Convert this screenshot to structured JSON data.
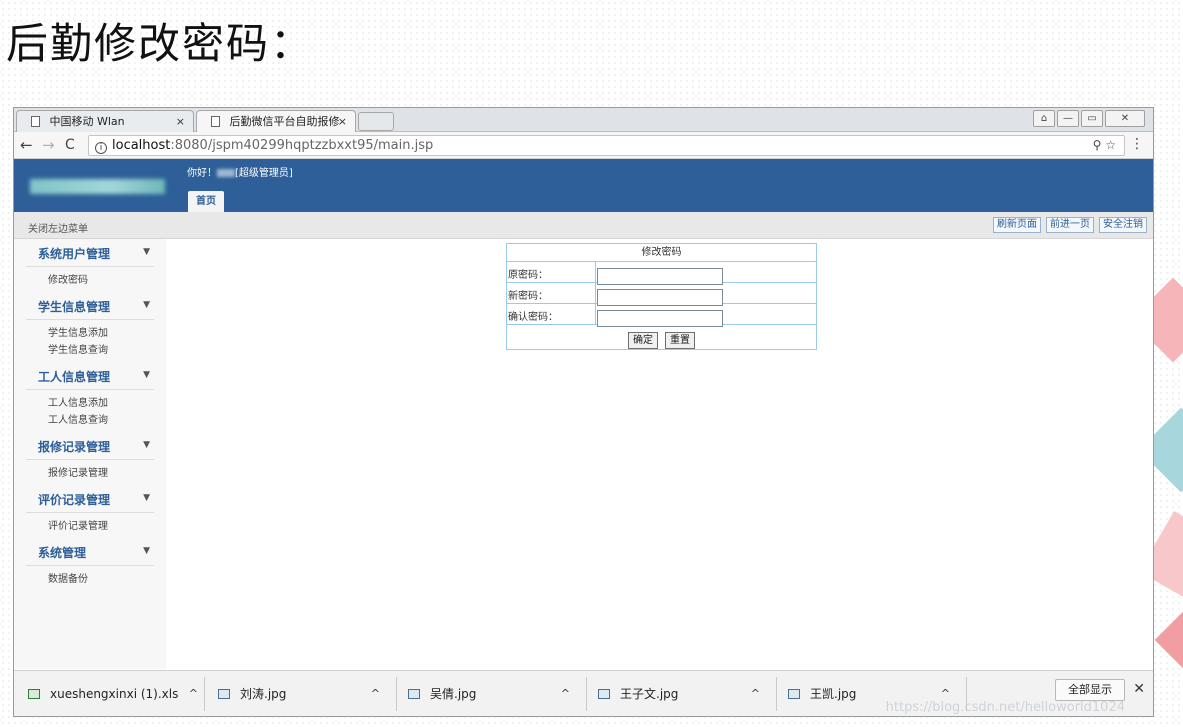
{
  "slide_title": "后勤修改密码：",
  "browser": {
    "tabs": [
      {
        "title": "中国移动 Wlan",
        "close": "×"
      },
      {
        "title": "后勤微信平台自助报修系",
        "close": "×"
      }
    ],
    "window_controls": {
      "user": "⌂",
      "minimize": "—",
      "maximize": "▭",
      "close": "✕"
    },
    "url_host": "localhost",
    "url_path": ":8080/jspm40299hqptzzbxxt95/main.jsp",
    "nav": {
      "back": "←",
      "forward": "→",
      "reload": "C"
    },
    "info_icon": "i",
    "omnibox_icons": "⚲ ☆",
    "menu": "⋮"
  },
  "app": {
    "greeting_prefix": "你好！",
    "greeting_role": "[超级管理员]",
    "home_tab": "首页",
    "toggle_menu": "关闭左边菜单",
    "actions": {
      "refresh": "刷新页面",
      "forward": "前进一页",
      "logout": "安全注销"
    },
    "sidebar": {
      "chevron": "▼",
      "g1": {
        "title": "系统用户管理",
        "items": [
          "修改密码"
        ]
      },
      "g2": {
        "title": "学生信息管理",
        "items": [
          "学生信息添加",
          "学生信息查询"
        ]
      },
      "g3": {
        "title": "工人信息管理",
        "items": [
          "工人信息添加",
          "工人信息查询"
        ]
      },
      "g4": {
        "title": "报修记录管理",
        "items": [
          "报修记录管理"
        ]
      },
      "g5": {
        "title": "评价记录管理",
        "items": [
          "评价记录管理"
        ]
      },
      "g6": {
        "title": "系统管理",
        "items": [
          "数据备份"
        ]
      }
    },
    "form": {
      "title": "修改密码",
      "old_label": "原密码：",
      "new_label": "新密码：",
      "confirm_label": "确认密码：",
      "old_value": "",
      "new_value": "",
      "confirm_value": "",
      "submit": "确定",
      "reset": "重置"
    }
  },
  "downloads": {
    "items": [
      {
        "name": "xueshengxinxi (1).xls"
      },
      {
        "name": "刘涛.jpg"
      },
      {
        "name": "吴倩.jpg"
      },
      {
        "name": "王子文.jpg"
      },
      {
        "name": "王凯.jpg"
      }
    ],
    "chevron": "^",
    "show_all": "全部显示",
    "close": "✕"
  },
  "watermark": "https://blog.csdn.net/helloworld1024"
}
